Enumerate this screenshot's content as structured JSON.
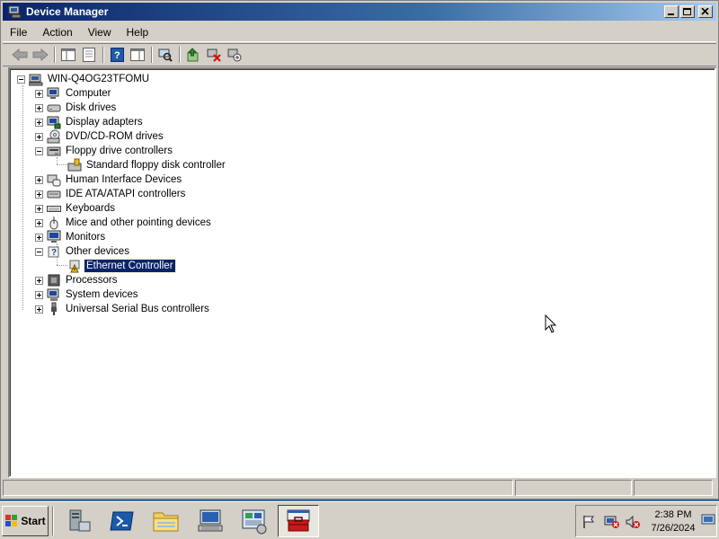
{
  "window": {
    "title": "Device Manager"
  },
  "menu": [
    "File",
    "Action",
    "View",
    "Help"
  ],
  "toolbar": {
    "icons": [
      "back-icon",
      "forward-icon",
      "console-tree-icon",
      "properties-icon",
      "help-icon",
      "action-pane-icon",
      "scan-hardware-icon",
      "update-driver-icon",
      "uninstall-icon",
      "enable-device-icon"
    ]
  },
  "tree": {
    "root": "WIN-Q4OG23TFOMU",
    "items": [
      {
        "label": "Computer",
        "expanded": false,
        "icon": "computer-icon"
      },
      {
        "label": "Disk drives",
        "expanded": false,
        "icon": "disk-drive-icon"
      },
      {
        "label": "Display adapters",
        "expanded": false,
        "icon": "display-adapter-icon"
      },
      {
        "label": "DVD/CD-ROM drives",
        "expanded": false,
        "icon": "dvd-drive-icon"
      },
      {
        "label": "Floppy drive controllers",
        "expanded": true,
        "icon": "floppy-controller-icon"
      },
      {
        "label": "Standard floppy disk controller",
        "child": true,
        "icon": "floppy-controller-icon"
      },
      {
        "label": "Human Interface Devices",
        "expanded": false,
        "icon": "hid-icon"
      },
      {
        "label": "IDE ATA/ATAPI controllers",
        "expanded": false,
        "icon": "ide-controller-icon"
      },
      {
        "label": "Keyboards",
        "expanded": false,
        "icon": "keyboard-icon"
      },
      {
        "label": "Mice and other pointing devices",
        "expanded": false,
        "icon": "mouse-icon"
      },
      {
        "label": "Monitors",
        "expanded": false,
        "icon": "monitor-icon"
      },
      {
        "label": "Other devices",
        "expanded": true,
        "icon": "other-devices-icon"
      },
      {
        "label": "Ethernet Controller",
        "child": true,
        "selected": true,
        "warning": true,
        "icon": "warning-device-icon"
      },
      {
        "label": "Processors",
        "expanded": false,
        "icon": "processor-icon"
      },
      {
        "label": "System devices",
        "expanded": false,
        "icon": "system-devices-icon"
      },
      {
        "label": "Universal Serial Bus controllers",
        "expanded": false,
        "icon": "usb-icon"
      }
    ]
  },
  "taskbar": {
    "start_label": "Start",
    "buttons": [
      "server-manager-icon",
      "powershell-icon",
      "explorer-icon",
      "remote-desktop-icon",
      "control-panel-icon",
      "toolbox-icon"
    ],
    "active_index": 5,
    "time": "2:38 PM",
    "date": "7/26/2024"
  },
  "colors": {
    "selection": "#0a246a",
    "titlebar_start": "#0a246a",
    "titlebar_end": "#a6caf0",
    "face": "#d4d0c8"
  }
}
